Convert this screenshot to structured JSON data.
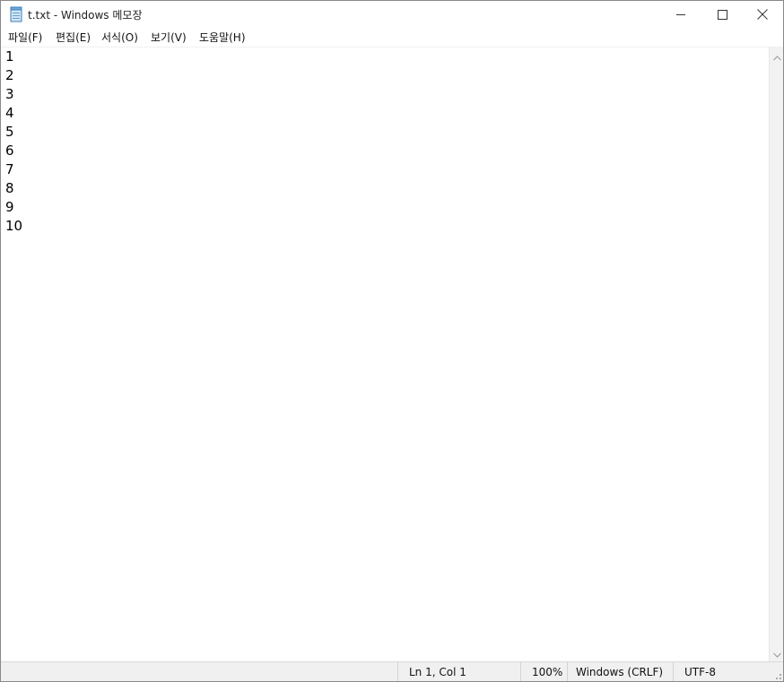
{
  "window": {
    "title": "t.txt - Windows 메모장",
    "app_icon": "notepad-icon"
  },
  "controls": {
    "minimize_icon": "minimize-icon",
    "maximize_icon": "maximize-icon",
    "close_icon": "close-icon"
  },
  "menu": {
    "items": [
      {
        "label": "파일(F)"
      },
      {
        "label": "편집(E)"
      },
      {
        "label": "서식(O)"
      },
      {
        "label": "보기(V)"
      },
      {
        "label": "도움말(H)"
      }
    ]
  },
  "editor": {
    "lines": [
      "1",
      "2",
      "3",
      "4",
      "5",
      "6",
      "7",
      "8",
      "9",
      "10"
    ]
  },
  "status": {
    "position": "Ln 1, Col 1",
    "zoom": "100%",
    "line_ending": "Windows (CRLF)",
    "encoding": "UTF-8"
  },
  "colors": {
    "statusbar": "#f0f0f0",
    "scrollbar": "#f2f2f2",
    "text": "#000000"
  }
}
